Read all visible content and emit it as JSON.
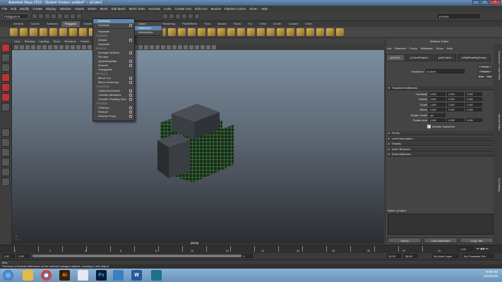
{
  "window": {
    "title": "Autodesk Maya 2015 - Student Version: untitled*  ---  pCube1"
  },
  "menubar": [
    "File",
    "Edit",
    "Modify",
    "Create",
    "Display",
    "Window",
    "Assets",
    "Select",
    "Mesh",
    "Edit Mesh",
    "Mesh Tools",
    "Normals",
    "Color",
    "Create UVs",
    "Edit UVs",
    "Muscle",
    "Pipeline Cache",
    "XGen",
    "Help"
  ],
  "statusline": {
    "mode": "Polygons",
    "object_field": "pCube1"
  },
  "shelf_tabs": [
    "General",
    "Curves",
    "Surfaces",
    "Polygons",
    "Subdivs",
    "Deformation",
    "Animation",
    "Dynamics",
    "Rendering",
    "PaintEffects",
    "Toon",
    "Muscle",
    "Fluids",
    "Fur",
    "nHair",
    "nCloth",
    "Custom",
    "XGen"
  ],
  "panel_menu": [
    "View",
    "Shading",
    "Lighting",
    "Show",
    "Renderer",
    "Panels"
  ],
  "viewport": {
    "camera_label": "persp"
  },
  "mesh_menu": {
    "items": [
      {
        "label": "Booleans",
        "highlight": true
      },
      {
        "label": "Combine",
        "option": true
      },
      {
        "label": "Separate",
        "section": "REMOVE",
        "option": false
      },
      {
        "label": "Extract",
        "option": true
      },
      {
        "label": "Separate"
      },
      {
        "label": "Average Vertices",
        "option": true
      },
      {
        "label": "Fill Hole"
      },
      {
        "label": "Quadrangulate",
        "option": true
      },
      {
        "label": "Smooth",
        "option": true
      },
      {
        "label": "Triangulate"
      },
      {
        "label": "Mirror Cut",
        "option": true
      },
      {
        "label": "Mirror Geometry",
        "option": true
      },
      {
        "label": "Clipboard Actions",
        "option": true
      },
      {
        "label": "Transfer Attributes",
        "option": true
      },
      {
        "label": "Transfer Shading Sets",
        "option": true
      },
      {
        "label": "Cleanup...",
        "option": true
      },
      {
        "label": "Reduce",
        "option": true
      },
      {
        "label": "Smooth Proxy",
        "option": true
      }
    ],
    "sections": [
      "COMBINE",
      "REMOVE",
      "OPTIMIZE",
      "SHAPE",
      "TRANSFER",
      "OPTIMIZE"
    ]
  },
  "booleans_submenu": [
    "Union",
    "Difference",
    "Intersection"
  ],
  "attribute_editor": {
    "title": "Attribute Editor",
    "menus": [
      "List",
      "Selected",
      "Focus",
      "Attributes",
      "Show",
      "Help"
    ],
    "tabs": [
      "pCube1",
      "pCubeShape1",
      "polyCube1",
      "initialShadingGroup"
    ],
    "transform_label": "transform:",
    "transform_value": "pCube1",
    "side_buttons": [
      "Focus",
      "Presets",
      "Show",
      "Hide"
    ],
    "transform_attributes_title": "Transform Attributes",
    "rows": [
      {
        "label": "Translate",
        "values": [
          "0.000",
          "0.000",
          "0.000"
        ]
      },
      {
        "label": "Rotate",
        "values": [
          "0.000",
          "0.000",
          "0.000"
        ]
      },
      {
        "label": "Scale",
        "values": [
          "1.000",
          "1.000",
          "1.000"
        ]
      },
      {
        "label": "Shear",
        "values": [
          "0.000",
          "0.000",
          "0.000"
        ]
      },
      {
        "label": "Rotate Order",
        "values": [
          "xyz"
        ]
      },
      {
        "label": "Rotate Axis",
        "values": [
          "0.000",
          "0.000",
          "0.000"
        ]
      }
    ],
    "inherits_label": "Inherits Transform",
    "sections": [
      "Pivots",
      "Limit Information",
      "Display",
      "Node Behavior",
      "Extra Attributes"
    ],
    "notes_label": "Notes: pCube1",
    "bottom_buttons": [
      "Select",
      "Load Attributes",
      "Copy Tab"
    ]
  },
  "side_tabs": [
    "Channel Box / Layer Editor",
    "Attribute Editor",
    "Tool Settings"
  ],
  "time": {
    "start": "1.00",
    "current": "1.00",
    "range_start": "1",
    "range_end": "24.00",
    "end": "48.00",
    "anim_end": "120",
    "char_set": "No Character Set",
    "anim_layer": "No Anim Layer"
  },
  "tick_labels": [
    "1",
    "2",
    "4",
    "6",
    "8",
    "10",
    "12",
    "14",
    "16",
    "18",
    "20",
    "22",
    "24"
  ],
  "command_line": {
    "mode": "MEL"
  },
  "help_line": "Performs a boolean difference on the selected polygon objects, creating a new object.",
  "taskbar": {
    "clock_time": "9:59 AM",
    "clock_date": "2/21/2015"
  }
}
